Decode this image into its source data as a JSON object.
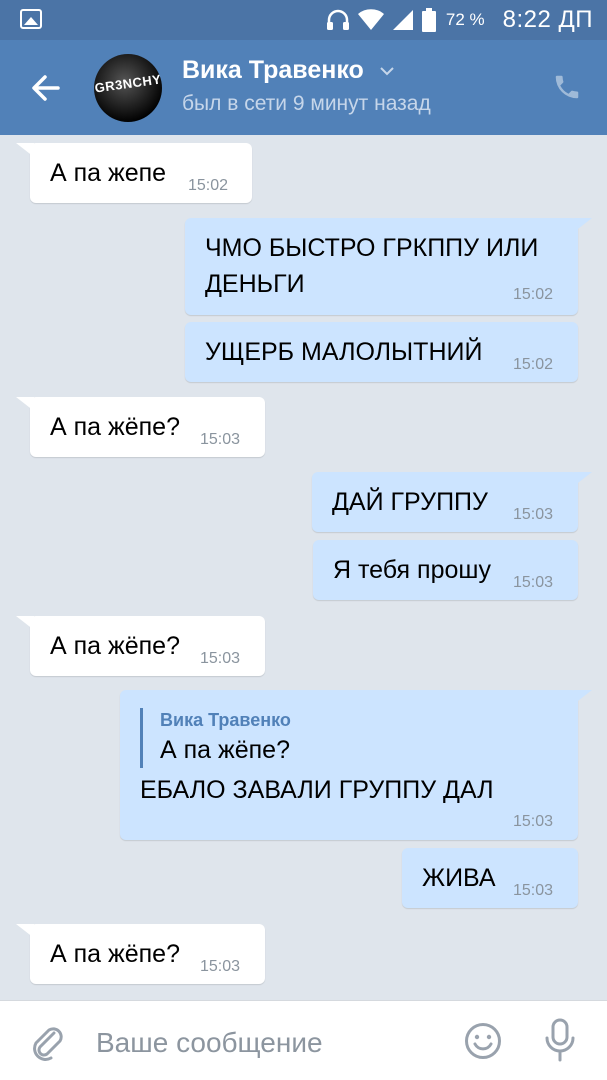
{
  "status_bar": {
    "battery_percent": "72 %",
    "time": "8:22 ДП"
  },
  "header": {
    "contact_name": "Вика Травенко",
    "contact_status": "был в сети 9 минут назад",
    "avatar_text": "GR3NCHY"
  },
  "messages": [
    {
      "dir": "in",
      "text": "А па жепе",
      "time": "15:02"
    },
    {
      "dir": "out",
      "text_line1": "ЧМО БЫСТРО ГРКППУ ИЛИ",
      "text_line2": "ДЕНЬГИ",
      "time": "15:02"
    },
    {
      "dir": "out",
      "text": "УЩЕРБ МАЛОЛЫТНИЙ",
      "time": "15:02"
    },
    {
      "dir": "in",
      "text": "А па жёпе?",
      "time": "15:03"
    },
    {
      "dir": "out",
      "text": "ДАЙ ГРУППУ",
      "time": "15:03"
    },
    {
      "dir": "out",
      "text": "Я тебя прошу",
      "time": "15:03"
    },
    {
      "dir": "in",
      "text": "А па жёпе?",
      "time": "15:03"
    },
    {
      "dir": "out",
      "reply_name": "Вика Травенко",
      "reply_text": "А па жёпе?",
      "text": "ЕБАЛО ЗАВАЛИ ГРУППУ ДАЛ",
      "time": "15:03"
    },
    {
      "dir": "out",
      "text": "ЖИВА",
      "time": "15:03"
    },
    {
      "dir": "in",
      "text": "А па жёпе?",
      "time": "15:03"
    }
  ],
  "input": {
    "placeholder": "Ваше сообщение"
  },
  "colors": {
    "header": "#5181b8",
    "status_bar": "#4b74a6",
    "chat_background": "#dfe5ec",
    "outgoing_bubble": "#cce4ff",
    "incoming_bubble": "#ffffff"
  },
  "icons": [
    "gallery-icon",
    "headphones-icon",
    "wifi-icon",
    "signal-icon",
    "battery-icon",
    "back-arrow-icon",
    "chevron-down-icon",
    "phone-icon",
    "paperclip-icon",
    "smile-icon",
    "microphone-icon"
  ]
}
